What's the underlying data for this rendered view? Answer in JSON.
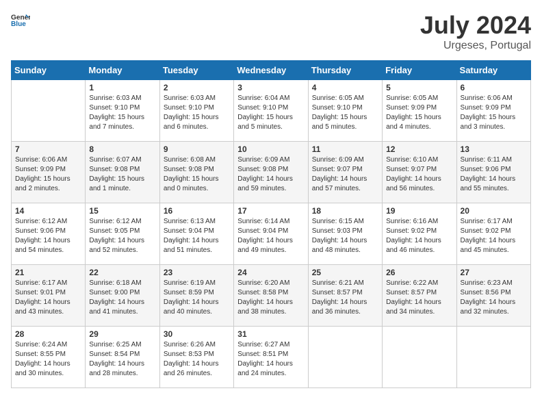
{
  "logo": {
    "text_general": "General",
    "text_blue": "Blue"
  },
  "title": "July 2024",
  "location": "Urgeses, Portugal",
  "days_of_week": [
    "Sunday",
    "Monday",
    "Tuesday",
    "Wednesday",
    "Thursday",
    "Friday",
    "Saturday"
  ],
  "weeks": [
    [
      {
        "day": "",
        "info": ""
      },
      {
        "day": "1",
        "info": "Sunrise: 6:03 AM\nSunset: 9:10 PM\nDaylight: 15 hours\nand 7 minutes."
      },
      {
        "day": "2",
        "info": "Sunrise: 6:03 AM\nSunset: 9:10 PM\nDaylight: 15 hours\nand 6 minutes."
      },
      {
        "day": "3",
        "info": "Sunrise: 6:04 AM\nSunset: 9:10 PM\nDaylight: 15 hours\nand 5 minutes."
      },
      {
        "day": "4",
        "info": "Sunrise: 6:05 AM\nSunset: 9:10 PM\nDaylight: 15 hours\nand 5 minutes."
      },
      {
        "day": "5",
        "info": "Sunrise: 6:05 AM\nSunset: 9:09 PM\nDaylight: 15 hours\nand 4 minutes."
      },
      {
        "day": "6",
        "info": "Sunrise: 6:06 AM\nSunset: 9:09 PM\nDaylight: 15 hours\nand 3 minutes."
      }
    ],
    [
      {
        "day": "7",
        "info": "Sunrise: 6:06 AM\nSunset: 9:09 PM\nDaylight: 15 hours\nand 2 minutes."
      },
      {
        "day": "8",
        "info": "Sunrise: 6:07 AM\nSunset: 9:08 PM\nDaylight: 15 hours\nand 1 minute."
      },
      {
        "day": "9",
        "info": "Sunrise: 6:08 AM\nSunset: 9:08 PM\nDaylight: 15 hours\nand 0 minutes."
      },
      {
        "day": "10",
        "info": "Sunrise: 6:09 AM\nSunset: 9:08 PM\nDaylight: 14 hours\nand 59 minutes."
      },
      {
        "day": "11",
        "info": "Sunrise: 6:09 AM\nSunset: 9:07 PM\nDaylight: 14 hours\nand 57 minutes."
      },
      {
        "day": "12",
        "info": "Sunrise: 6:10 AM\nSunset: 9:07 PM\nDaylight: 14 hours\nand 56 minutes."
      },
      {
        "day": "13",
        "info": "Sunrise: 6:11 AM\nSunset: 9:06 PM\nDaylight: 14 hours\nand 55 minutes."
      }
    ],
    [
      {
        "day": "14",
        "info": "Sunrise: 6:12 AM\nSunset: 9:06 PM\nDaylight: 14 hours\nand 54 minutes."
      },
      {
        "day": "15",
        "info": "Sunrise: 6:12 AM\nSunset: 9:05 PM\nDaylight: 14 hours\nand 52 minutes."
      },
      {
        "day": "16",
        "info": "Sunrise: 6:13 AM\nSunset: 9:04 PM\nDaylight: 14 hours\nand 51 minutes."
      },
      {
        "day": "17",
        "info": "Sunrise: 6:14 AM\nSunset: 9:04 PM\nDaylight: 14 hours\nand 49 minutes."
      },
      {
        "day": "18",
        "info": "Sunrise: 6:15 AM\nSunset: 9:03 PM\nDaylight: 14 hours\nand 48 minutes."
      },
      {
        "day": "19",
        "info": "Sunrise: 6:16 AM\nSunset: 9:02 PM\nDaylight: 14 hours\nand 46 minutes."
      },
      {
        "day": "20",
        "info": "Sunrise: 6:17 AM\nSunset: 9:02 PM\nDaylight: 14 hours\nand 45 minutes."
      }
    ],
    [
      {
        "day": "21",
        "info": "Sunrise: 6:17 AM\nSunset: 9:01 PM\nDaylight: 14 hours\nand 43 minutes."
      },
      {
        "day": "22",
        "info": "Sunrise: 6:18 AM\nSunset: 9:00 PM\nDaylight: 14 hours\nand 41 minutes."
      },
      {
        "day": "23",
        "info": "Sunrise: 6:19 AM\nSunset: 8:59 PM\nDaylight: 14 hours\nand 40 minutes."
      },
      {
        "day": "24",
        "info": "Sunrise: 6:20 AM\nSunset: 8:58 PM\nDaylight: 14 hours\nand 38 minutes."
      },
      {
        "day": "25",
        "info": "Sunrise: 6:21 AM\nSunset: 8:57 PM\nDaylight: 14 hours\nand 36 minutes."
      },
      {
        "day": "26",
        "info": "Sunrise: 6:22 AM\nSunset: 8:57 PM\nDaylight: 14 hours\nand 34 minutes."
      },
      {
        "day": "27",
        "info": "Sunrise: 6:23 AM\nSunset: 8:56 PM\nDaylight: 14 hours\nand 32 minutes."
      }
    ],
    [
      {
        "day": "28",
        "info": "Sunrise: 6:24 AM\nSunset: 8:55 PM\nDaylight: 14 hours\nand 30 minutes."
      },
      {
        "day": "29",
        "info": "Sunrise: 6:25 AM\nSunset: 8:54 PM\nDaylight: 14 hours\nand 28 minutes."
      },
      {
        "day": "30",
        "info": "Sunrise: 6:26 AM\nSunset: 8:53 PM\nDaylight: 14 hours\nand 26 minutes."
      },
      {
        "day": "31",
        "info": "Sunrise: 6:27 AM\nSunset: 8:51 PM\nDaylight: 14 hours\nand 24 minutes."
      },
      {
        "day": "",
        "info": ""
      },
      {
        "day": "",
        "info": ""
      },
      {
        "day": "",
        "info": ""
      }
    ]
  ]
}
